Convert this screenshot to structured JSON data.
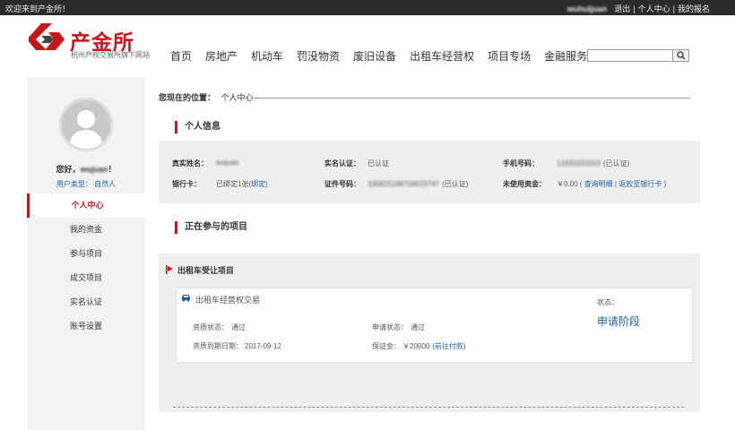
{
  "topbar": {
    "welcome": "欢迎来到产金所！",
    "username": "wuhuljuan",
    "logout": "退出",
    "personal_center": "个人中心",
    "my_signup": "我的报名"
  },
  "header": {
    "logo_text": "产金所",
    "logo_sub": "杭州产权交易所旗下网站",
    "brand_color": "#c8161d",
    "nav": [
      "首页",
      "房地产",
      "机动车",
      "罚没物资",
      "废旧设备",
      "出租车经营权",
      "项目专场",
      "金融服务"
    ],
    "search_placeholder": ""
  },
  "sidebar": {
    "greeting": "您好，",
    "username": "wujuan",
    "greeting_suffix": "！",
    "user_type": "用户类型：  自然人",
    "menu": [
      "个人中心",
      "我的资金",
      "参与项目",
      "成交项目",
      "实名认证",
      "账号设置"
    ],
    "active_index": 0
  },
  "breadcrumb": {
    "label": "您现在的位置：",
    "current": "个人中心"
  },
  "personal_info": {
    "title": "个人信息",
    "real_name_label": "真实姓名：",
    "real_name": "wujuan",
    "verify_label": "实名认证：",
    "verify_value": "已认证",
    "phone_label": "手机号码：",
    "phone_value": "13333333333",
    "phone_status": "(已认证)",
    "bank_label": "银行卡：",
    "bank_value": "已绑定1张(",
    "bank_link": "绑定",
    "bank_close": ")",
    "id_label": "证件号码：",
    "id_value": "330825198709023747",
    "id_status": "(已认证)",
    "funds_label": "未使用资金：",
    "funds_value": "￥0.00",
    "funds_link1": "查询明细",
    "funds_link2": "返款至银行卡"
  },
  "projects": {
    "title": "正在参与的项目",
    "group_title": "出租车受让项目",
    "card": {
      "name": "出租车经营权交易",
      "status_label": "状态：",
      "status_value": "申请阶段",
      "qual_label": "资质状态：",
      "qual_value": "通过",
      "apply_label": "申请状态：",
      "apply_value": "通过",
      "expire_label": "资质到期日期：",
      "expire_value": "2017-09-12",
      "deposit_label": "保证金：",
      "deposit_value": "￥20000",
      "deposit_link": "(前往付款)"
    }
  }
}
